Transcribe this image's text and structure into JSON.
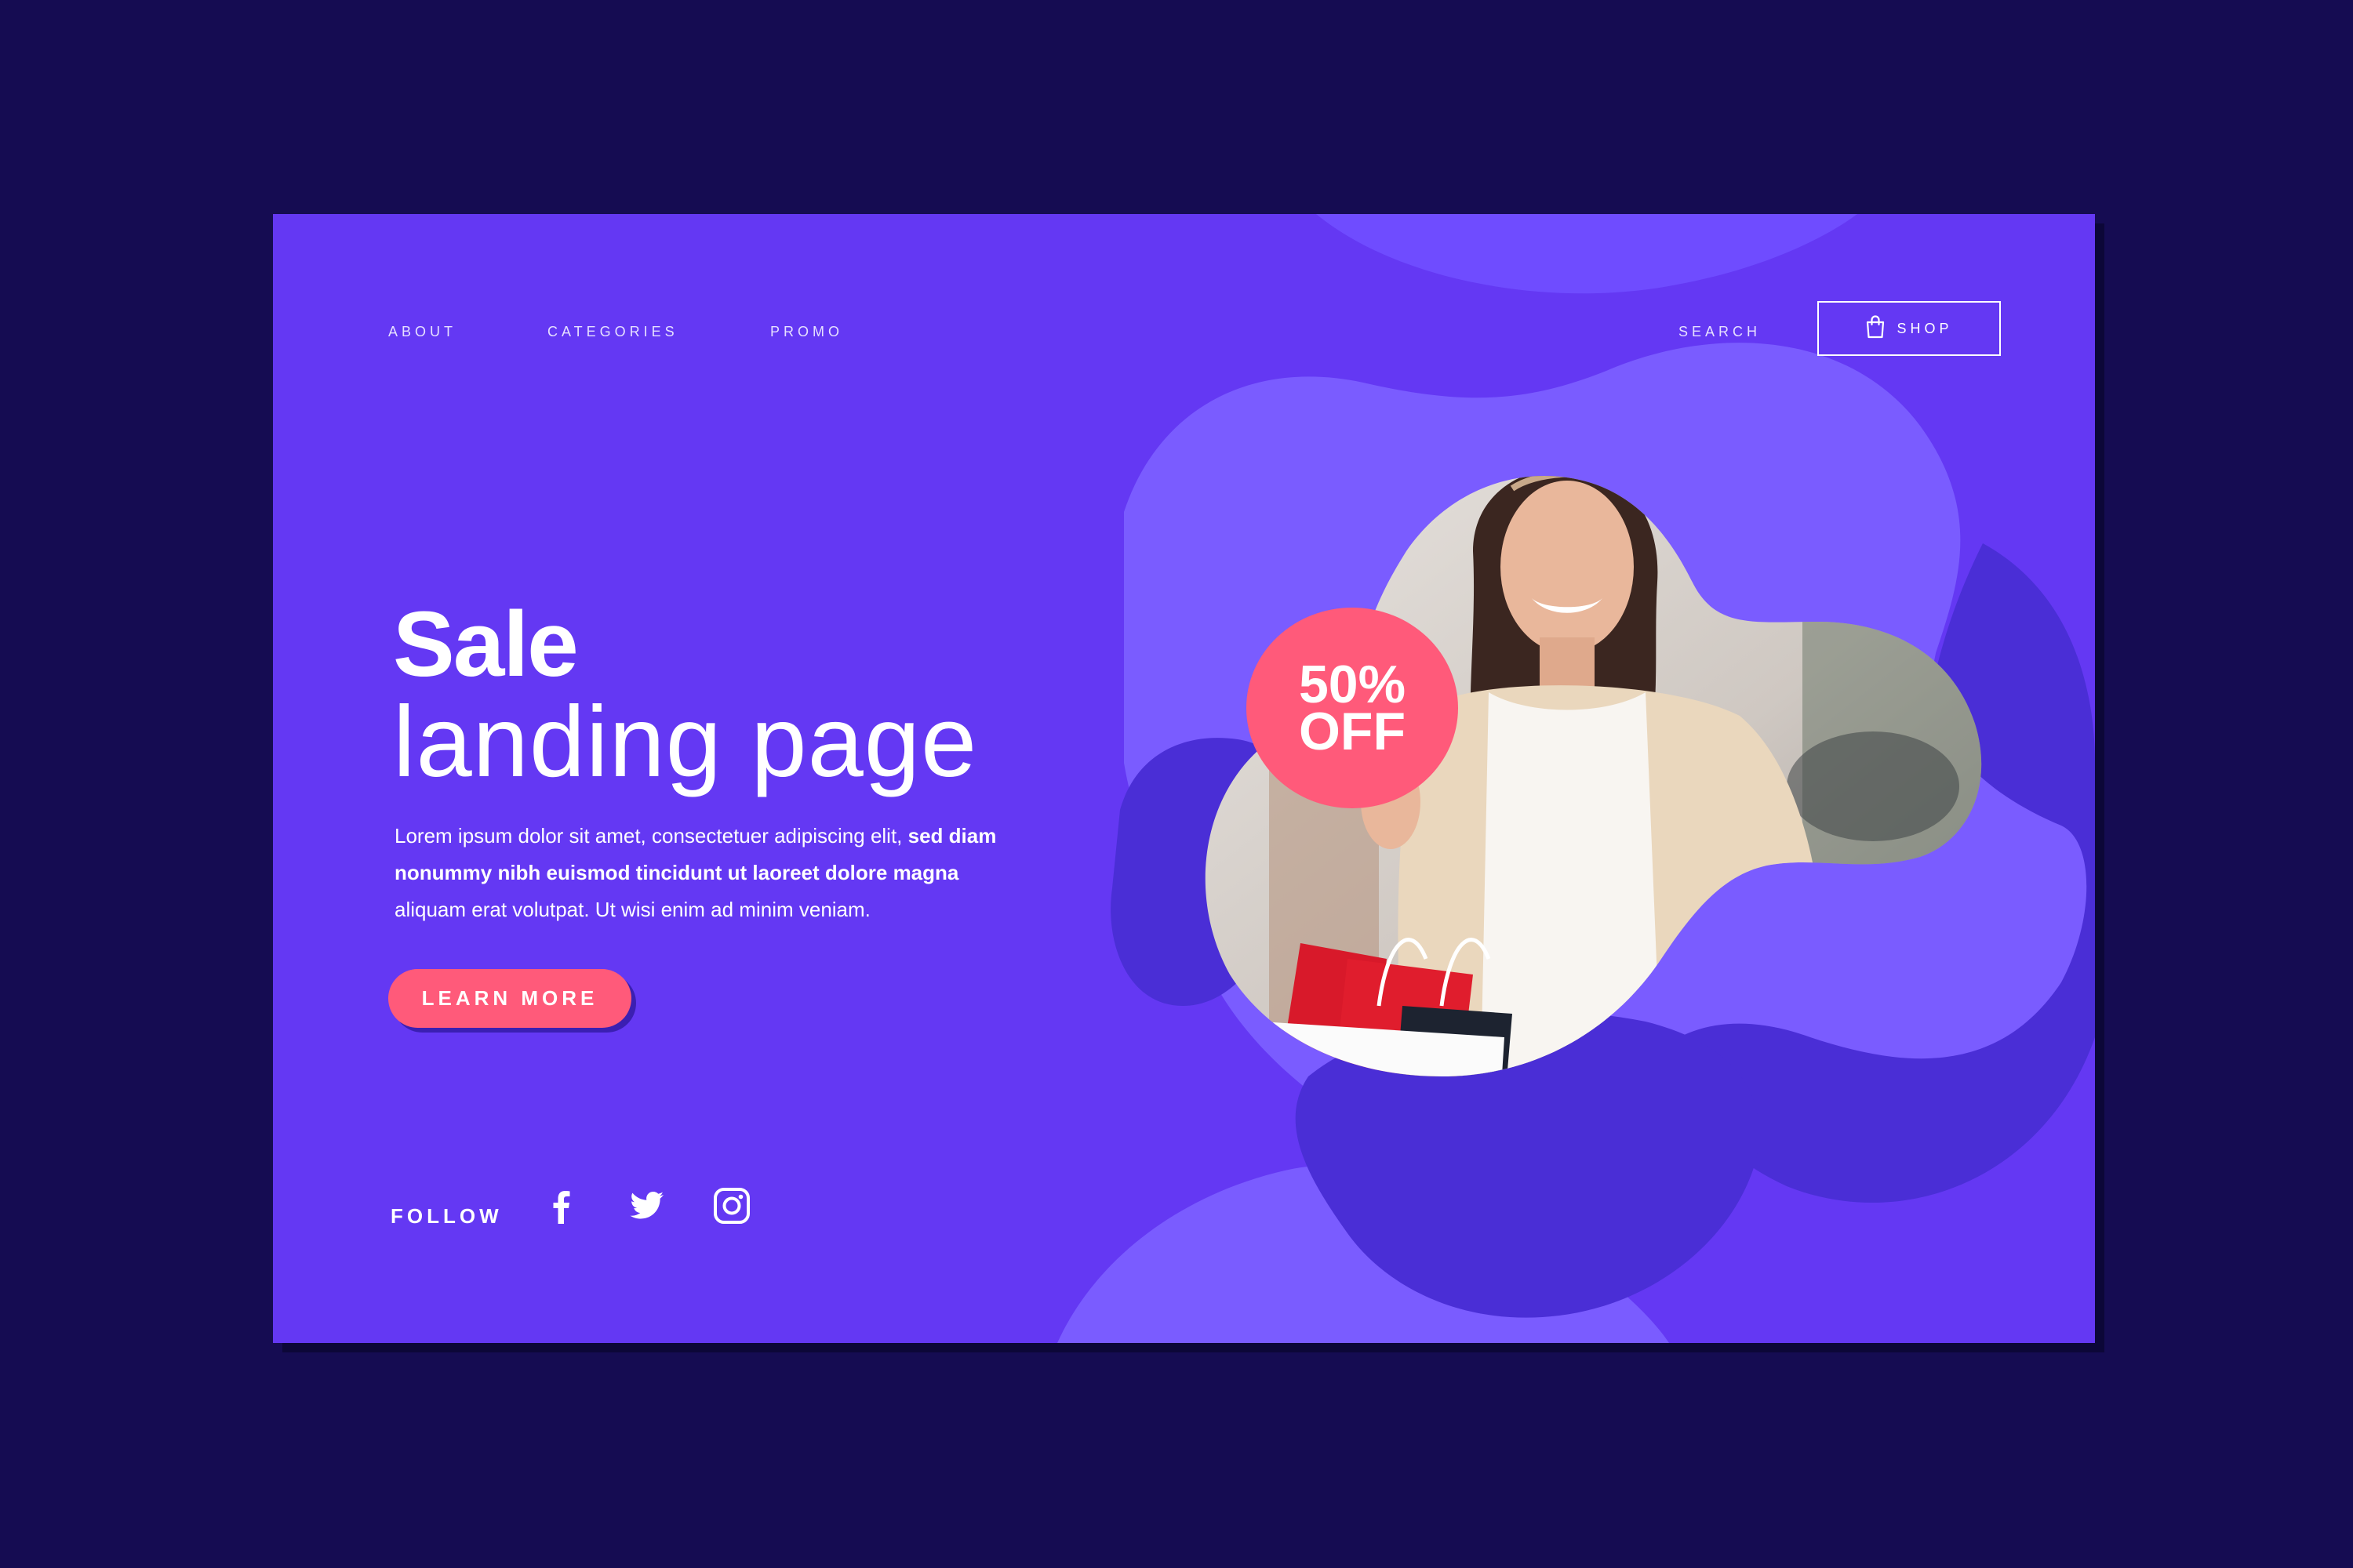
{
  "nav": {
    "about": "ABOUT",
    "categories": "CATEGORIES",
    "promo": "PROMO",
    "search": "SEARCH",
    "shop": "SHOP"
  },
  "hero": {
    "title_line1": "Sale",
    "title_line2": "landing page",
    "desc_part1": "Lorem ipsum dolor sit amet, consectetuer adipiscing elit, ",
    "desc_bold": "sed diam nonummy nibh euismod tincidunt ut laoreet dolore magna",
    "desc_part2": " aliquam erat volutpat. Ut wisi enim ad minim veniam.",
    "cta_label": "LEARN MORE"
  },
  "badge": {
    "line1": "50%",
    "line2": "OFF"
  },
  "follow": {
    "label": "FOLLOW",
    "icons": [
      "facebook-icon",
      "twitter-icon",
      "instagram-icon"
    ]
  },
  "colors": {
    "page_bg": "#150c52",
    "card_bg": "#6438f3",
    "blob_light": "#7a5cff",
    "blob_dark": "#4a2ed6",
    "accent": "#ff5a7a",
    "text": "#ffffff"
  }
}
